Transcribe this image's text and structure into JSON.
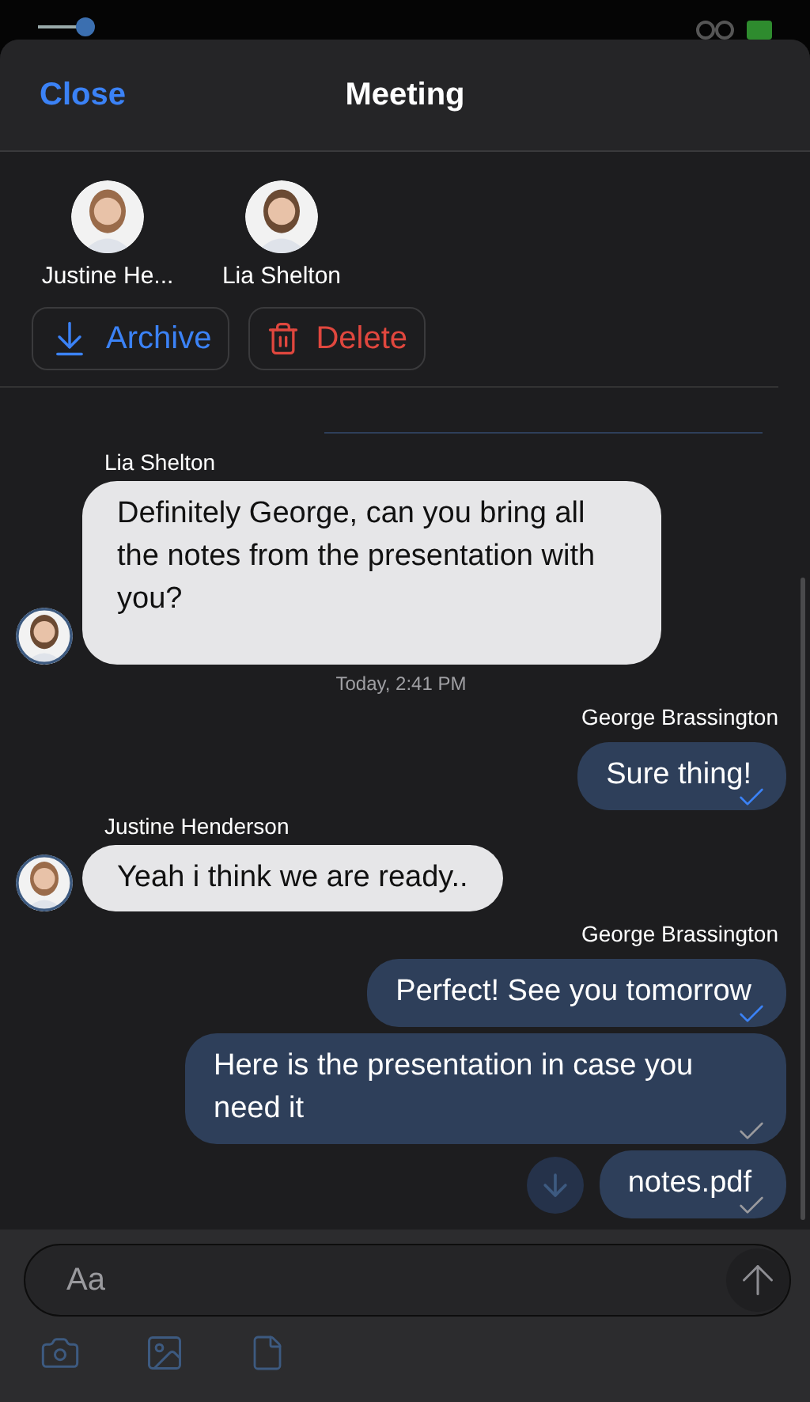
{
  "header": {
    "close": "Close",
    "title": "Meeting"
  },
  "participants": [
    {
      "name": "Justine He..."
    },
    {
      "name": "Lia Shelton"
    }
  ],
  "actions": [
    {
      "kind": "archive",
      "label": "Archive"
    },
    {
      "kind": "delete",
      "label": "Delete"
    }
  ],
  "messages": [
    {
      "kind": "sender_in",
      "text": "Lia Shelton"
    },
    {
      "kind": "incoming",
      "text": "Definitely George, can you bring all the notes from the presentation with you?"
    },
    {
      "kind": "timestamp",
      "text": "Today, 2:41 PM"
    },
    {
      "kind": "sender_out",
      "text": "George Brassington"
    },
    {
      "kind": "outgoing",
      "text": "Sure thing!",
      "read": true
    },
    {
      "kind": "sender_in",
      "text": "Justine Henderson"
    },
    {
      "kind": "incoming",
      "text": "Yeah i think we are ready.."
    },
    {
      "kind": "sender_out",
      "text": "George Brassington"
    },
    {
      "kind": "outgoing",
      "text": "Perfect! See you tomorrow",
      "read": true
    },
    {
      "kind": "outgoing",
      "text": "Here is the presentation in case you need it",
      "read": false
    },
    {
      "kind": "file",
      "text": "notes.pdf",
      "read": false
    }
  ],
  "composer": {
    "placeholder": "Aa"
  }
}
